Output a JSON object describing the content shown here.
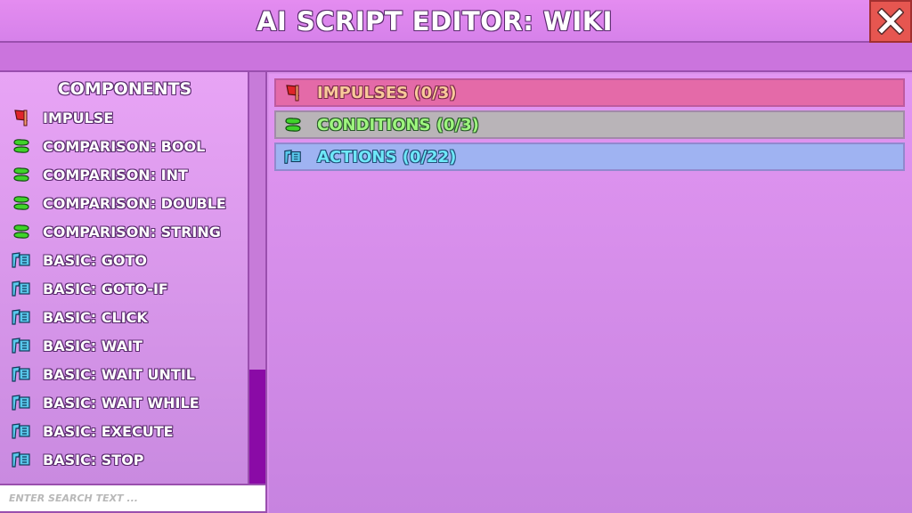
{
  "window": {
    "title": "AI SCRIPT EDITOR: WIKI",
    "close_icon": "close-x-icon"
  },
  "sidebar": {
    "heading": "COMPONENTS",
    "items": [
      {
        "label": "IMPULSE",
        "icon": "impulse-flag-icon"
      },
      {
        "label": "COMPARISON: BOOL",
        "icon": "condition-icon"
      },
      {
        "label": "COMPARISON: INT",
        "icon": "condition-icon"
      },
      {
        "label": "COMPARISON: DOUBLE",
        "icon": "condition-icon"
      },
      {
        "label": "COMPARISON: STRING",
        "icon": "condition-icon"
      },
      {
        "label": "BASIC: GOTO",
        "icon": "action-icon"
      },
      {
        "label": "BASIC: GOTO-IF",
        "icon": "action-icon"
      },
      {
        "label": "BASIC: CLICK",
        "icon": "action-icon"
      },
      {
        "label": "BASIC: WAIT",
        "icon": "action-icon"
      },
      {
        "label": "BASIC: WAIT UNTIL",
        "icon": "action-icon"
      },
      {
        "label": "BASIC: WAIT WHILE",
        "icon": "action-icon"
      },
      {
        "label": "BASIC: EXECUTE",
        "icon": "action-icon"
      },
      {
        "label": "BASIC: STOP",
        "icon": "action-icon"
      }
    ],
    "search": {
      "placeholder": "ENTER SEARCH TEXT ..."
    }
  },
  "main": {
    "sections": [
      {
        "label": "IMPULSES (0/3)",
        "icon": "impulse-flag-icon"
      },
      {
        "label": "CONDITIONS (0/3)",
        "icon": "condition-icon"
      },
      {
        "label": "ACTIONS (0/22)",
        "icon": "action-icon"
      }
    ]
  },
  "colors": {
    "impulse": "#e46aa8",
    "condition": "#b9b4b8",
    "action": "#9fb3f2",
    "close": "#e65650",
    "scroll_thumb": "#8a0aa6"
  }
}
